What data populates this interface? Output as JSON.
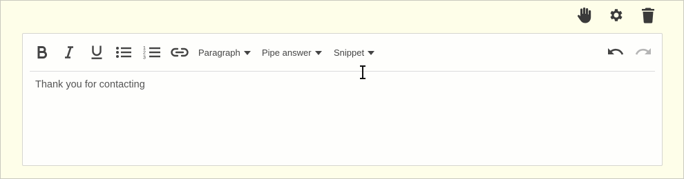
{
  "top_actions": {
    "hand_icon": "hand-icon",
    "gear_icon": "gear-icon",
    "trash_icon": "trash-icon"
  },
  "toolbar": {
    "buttons": [
      "bold-icon",
      "italic-icon",
      "underline-icon",
      "bullet-list-icon",
      "numbered-list-icon",
      "link-icon"
    ],
    "paragraph_label": "Paragraph",
    "pipe_answer_label": "Pipe answer",
    "snippet_label": "Snippet",
    "undo_icon": "undo-icon",
    "redo_icon": "redo-icon"
  },
  "editor": {
    "content": "Thank you for contacting"
  },
  "colors": {
    "background": "#fefee9",
    "icon": "#444444",
    "icon_disabled": "#b5b5b5"
  }
}
